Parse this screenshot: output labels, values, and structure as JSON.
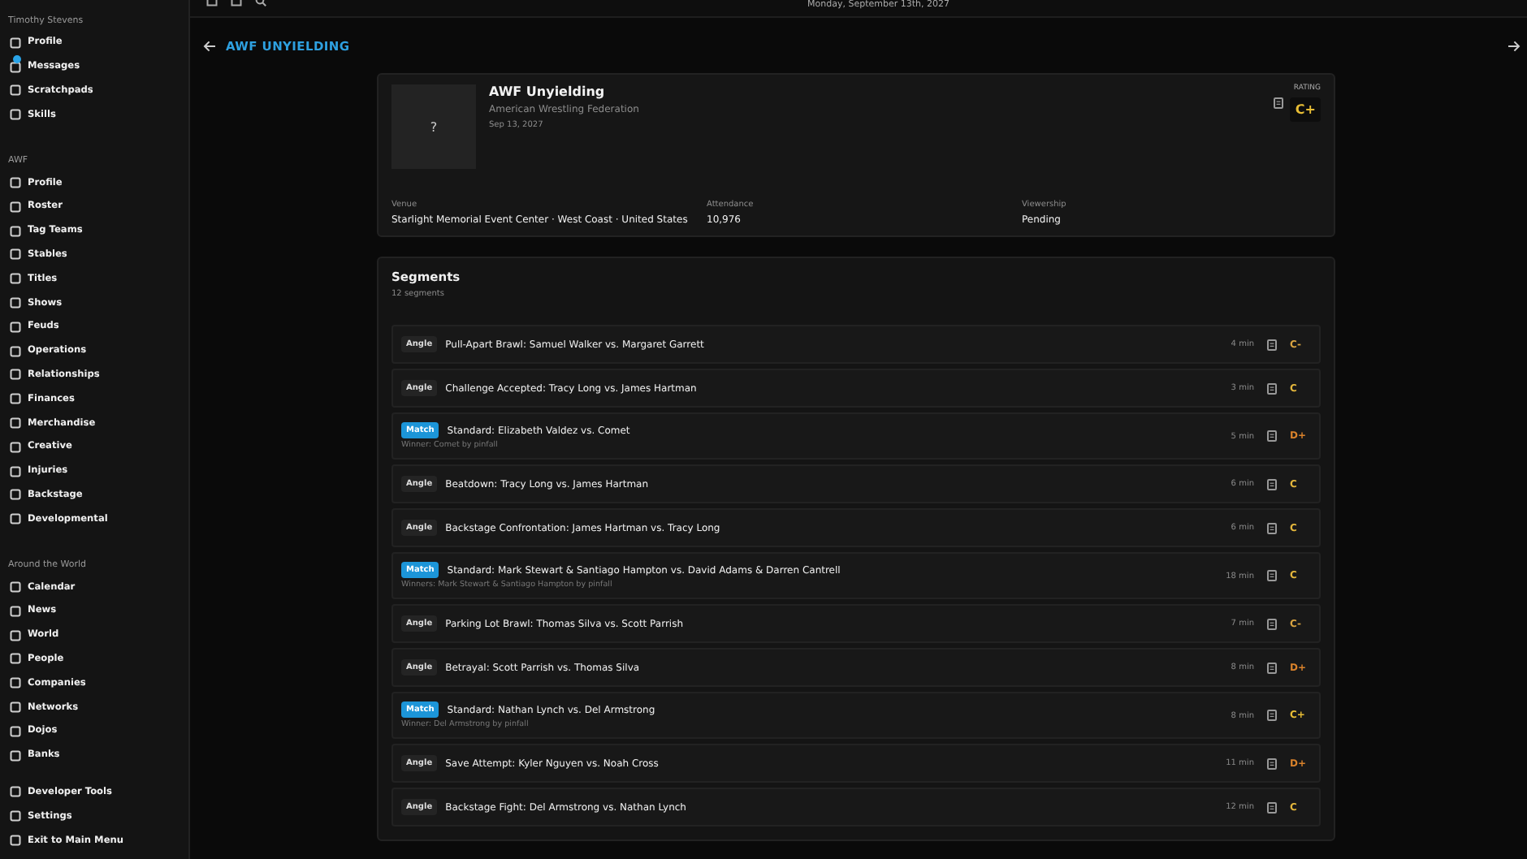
{
  "top_bar": {
    "date": "Monday, September 13th, 2027"
  },
  "sidebar": {
    "sections": [
      {
        "heading": "Timothy Stevens",
        "items": [
          {
            "label": "Profile",
            "unread": false
          },
          {
            "label": "Messages",
            "unread": true
          },
          {
            "label": "Scratchpads",
            "unread": false
          },
          {
            "label": "Skills",
            "unread": false
          }
        ]
      },
      {
        "heading": "AWF",
        "items": [
          {
            "label": "Profile",
            "unread": false
          },
          {
            "label": "Roster",
            "unread": false
          },
          {
            "label": "Tag Teams",
            "unread": false
          },
          {
            "label": "Stables",
            "unread": false
          },
          {
            "label": "Titles",
            "unread": false
          },
          {
            "label": "Shows",
            "unread": false
          },
          {
            "label": "Feuds",
            "unread": false
          },
          {
            "label": "Operations",
            "unread": false
          },
          {
            "label": "Relationships",
            "unread": false
          },
          {
            "label": "Finances",
            "unread": false
          },
          {
            "label": "Merchandise",
            "unread": false
          },
          {
            "label": "Creative",
            "unread": false
          },
          {
            "label": "Injuries",
            "unread": false
          },
          {
            "label": "Backstage",
            "unread": false
          },
          {
            "label": "Developmental",
            "unread": false
          }
        ]
      },
      {
        "heading": "Around the World",
        "items": [
          {
            "label": "Calendar",
            "unread": false
          },
          {
            "label": "News",
            "unread": false
          },
          {
            "label": "World",
            "unread": false
          },
          {
            "label": "People",
            "unread": false
          },
          {
            "label": "Companies",
            "unread": false
          },
          {
            "label": "Networks",
            "unread": false
          },
          {
            "label": "Dojos",
            "unread": false
          },
          {
            "label": "Banks",
            "unread": false
          }
        ]
      },
      {
        "items": [
          {
            "label": "Developer Tools",
            "unread": false
          },
          {
            "label": "Settings",
            "unread": false
          },
          {
            "label": "Exit to Main Menu",
            "unread": false
          }
        ]
      }
    ]
  },
  "page_title": "AWF UNYIELDING",
  "show_card": {
    "image": "?",
    "name": "AWF Unyielding",
    "company": "American Wrestling Federation",
    "date": "Sep 13, 2027",
    "rating_label": "RATING",
    "rating": "C+",
    "stats": [
      {
        "label": "Venue",
        "value": "Starlight Memorial Event Center · West Coast · United States"
      },
      {
        "label": "Attendance",
        "value": "10,976"
      },
      {
        "label": "Viewership",
        "value": "Pending"
      }
    ]
  },
  "segments": {
    "title": "Segments",
    "count": "12 segments",
    "rows": [
      {
        "kind": "angle",
        "tag": "Angle",
        "title": "Pull-Apart Brawl: Samuel Walker vs. Margaret Garrett",
        "duration": "4 min",
        "grade": "C-",
        "color": "#d9a441"
      },
      {
        "kind": "angle",
        "tag": "Angle",
        "title": "Challenge Accepted: Tracy Long vs. James Hartman",
        "duration": "3 min",
        "grade": "C",
        "color": "#e3b63c"
      },
      {
        "kind": "match",
        "tag": "Match",
        "title": "Standard: Elizabeth Valdez vs. Comet",
        "result": "Winner: Comet by pinfall",
        "duration": "5 min",
        "grade": "D+",
        "color": "#d9822b"
      },
      {
        "kind": "angle",
        "tag": "Angle",
        "title": "Beatdown: Tracy Long vs. James Hartman",
        "duration": "6 min",
        "grade": "C",
        "color": "#e3b63c"
      },
      {
        "kind": "angle",
        "tag": "Angle",
        "title": "Backstage Confrontation: James Hartman vs. Tracy Long",
        "duration": "6 min",
        "grade": "C",
        "color": "#e3b63c"
      },
      {
        "kind": "match",
        "tag": "Match",
        "title": "Standard: Mark Stewart & Santiago Hampton vs. David Adams & Darren Cantrell",
        "result": "Winners: Mark Stewart & Santiago Hampton by pinfall",
        "duration": "18 min",
        "grade": "C",
        "color": "#e3b63c"
      },
      {
        "kind": "angle",
        "tag": "Angle",
        "title": "Parking Lot Brawl: Thomas Silva vs. Scott Parrish",
        "duration": "7 min",
        "grade": "C-",
        "color": "#d9a441"
      },
      {
        "kind": "angle",
        "tag": "Angle",
        "title": "Betrayal: Scott Parrish vs. Thomas Silva",
        "duration": "8 min",
        "grade": "D+",
        "color": "#d9822b"
      },
      {
        "kind": "match",
        "tag": "Match",
        "title": "Standard: Nathan Lynch vs. Del Armstrong",
        "result": "Winner: Del Armstrong by pinfall",
        "duration": "8 min",
        "grade": "C+",
        "color": "#e8bd35"
      },
      {
        "kind": "angle",
        "tag": "Angle",
        "title": "Save Attempt: Kyler Nguyen vs. Noah Cross",
        "duration": "11 min",
        "grade": "D+",
        "color": "#d9822b"
      },
      {
        "kind": "angle",
        "tag": "Angle",
        "title": "Backstage Fight: Del Armstrong vs. Nathan Lynch",
        "duration": "12 min",
        "grade": "C",
        "color": "#e3b63c"
      }
    ]
  }
}
